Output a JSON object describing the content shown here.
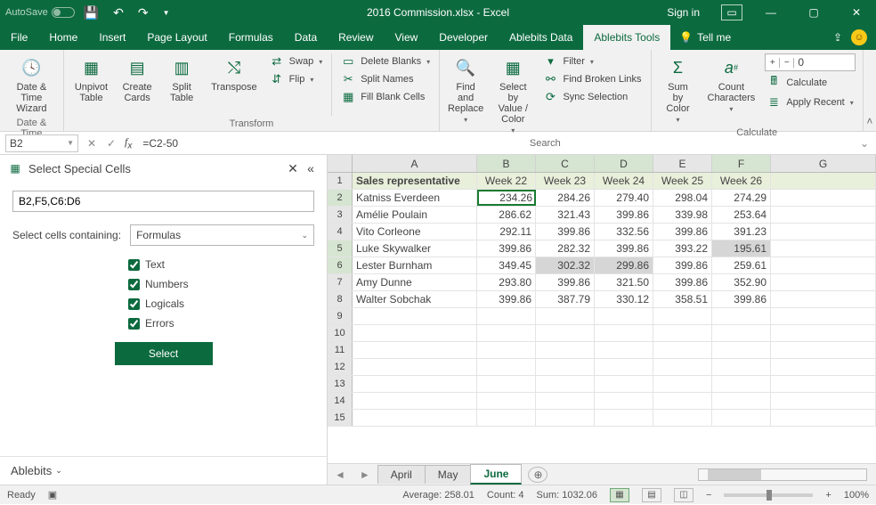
{
  "titlebar": {
    "autosave_label": "AutoSave",
    "autosave_state": "Off",
    "title": "2016 Commission.xlsx - Excel",
    "signin": "Sign in"
  },
  "tabs": {
    "items": [
      "File",
      "Home",
      "Insert",
      "Page Layout",
      "Formulas",
      "Data",
      "Review",
      "View",
      "Developer",
      "Ablebits Data",
      "Ablebits Tools"
    ],
    "active": "Ablebits Tools",
    "tellme": "Tell me"
  },
  "ribbon": {
    "date_time_wizard": "Date &\nTime Wizard",
    "group_datetime": "Date & Time",
    "unpivot_table": "Unpivot\nTable",
    "create_cards": "Create\nCards",
    "split_table": "Split\nTable",
    "transpose": "Transpose",
    "swap": "Swap",
    "flip": "Flip",
    "delete_blanks": "Delete Blanks",
    "split_names": "Split Names",
    "fill_blank": "Fill Blank Cells",
    "group_transform": "Transform",
    "find_replace": "Find and\nReplace",
    "select_by": "Select by\nValue / Color",
    "filter": "Filter",
    "find_broken": "Find Broken Links",
    "sync_selection": "Sync Selection",
    "group_search": "Search",
    "sum_by_color": "Sum by\nColor",
    "count_chars": "Count\nCharacters",
    "num_value": "0",
    "calculate": "Calculate",
    "apply_recent": "Apply Recent",
    "group_calculate": "Calculate"
  },
  "fbar": {
    "namebox": "B2",
    "formula": "=C2-50"
  },
  "taskpane": {
    "title": "Select Special Cells",
    "range": "B2,F5,C6:D6",
    "contain_label": "Select cells containing:",
    "contain_value": "Formulas",
    "checks": {
      "text": "Text",
      "numbers": "Numbers",
      "logicals": "Logicals",
      "errors": "Errors"
    },
    "button": "Select",
    "footer": "Ablebits"
  },
  "grid": {
    "columns": [
      "A",
      "B",
      "C",
      "D",
      "E",
      "F",
      "G"
    ],
    "header_row": [
      "Sales representative",
      "Week 22",
      "Week 23",
      "Week 24",
      "Week 25",
      "Week 26"
    ],
    "rows": [
      {
        "n": 2,
        "a": "Katniss Everdeen",
        "v": [
          "234.26",
          "284.26",
          "279.40",
          "298.04",
          "274.29"
        ]
      },
      {
        "n": 3,
        "a": "Amélie Poulain",
        "v": [
          "286.62",
          "321.43",
          "399.86",
          "339.98",
          "253.64"
        ]
      },
      {
        "n": 4,
        "a": "Vito Corleone",
        "v": [
          "292.11",
          "399.86",
          "332.56",
          "399.86",
          "391.23"
        ]
      },
      {
        "n": 5,
        "a": "Luke Skywalker",
        "v": [
          "399.86",
          "282.32",
          "399.86",
          "393.22",
          "195.61"
        ]
      },
      {
        "n": 6,
        "a": "Lester Burnham",
        "v": [
          "349.45",
          "302.32",
          "299.86",
          "399.86",
          "259.61"
        ]
      },
      {
        "n": 7,
        "a": "Amy Dunne",
        "v": [
          "293.80",
          "399.86",
          "321.50",
          "399.86",
          "352.90"
        ]
      },
      {
        "n": 8,
        "a": "Walter Sobchak",
        "v": [
          "399.86",
          "387.79",
          "330.12",
          "358.51",
          "399.86"
        ]
      }
    ]
  },
  "sheets": {
    "tabs": [
      "April",
      "May",
      "June"
    ],
    "active": "June"
  },
  "status": {
    "ready": "Ready",
    "average": "Average: 258.01",
    "count": "Count: 4",
    "sum": "Sum: 1032.06",
    "zoom": "100%"
  }
}
